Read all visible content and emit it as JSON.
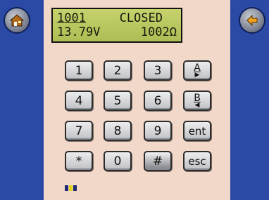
{
  "header": {
    "home_icon": "house-icon",
    "back_icon": "left-arrow-icon"
  },
  "lcd": {
    "line1_left": "1001",
    "line1_right": "CLOSED",
    "line2_left": "13.79V",
    "line2_right": "1002Ω"
  },
  "keypad": {
    "k1": "1",
    "k2": "2",
    "k3": "3",
    "k4": "4",
    "k5": "5",
    "k6": "6",
    "k7": "7",
    "k8": "8",
    "k9": "9",
    "kstar": "*",
    "k0": "0",
    "khash": "#",
    "kA": "A",
    "kB": "B",
    "kent": "ent",
    "kesc": "esc"
  },
  "colors": {
    "frame": "#1f3d8f",
    "panel": "#f1d8c9",
    "lcd": "#bcc65e",
    "battery": [
      "#1d2a70",
      "#e0d41c",
      "#1d2a70"
    ]
  }
}
